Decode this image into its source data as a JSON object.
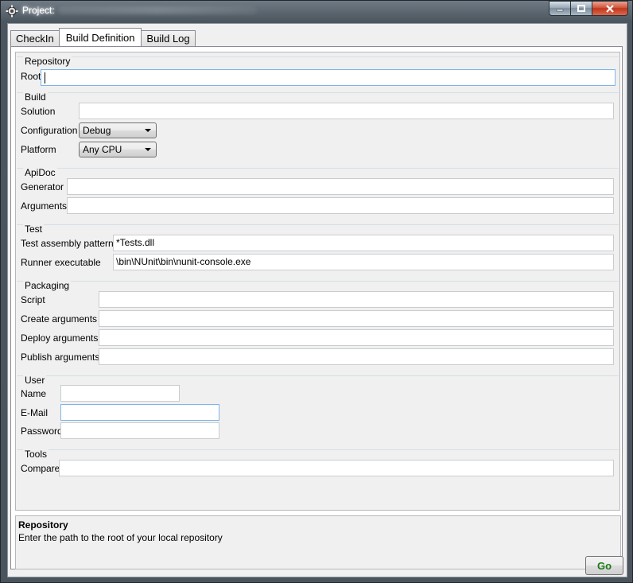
{
  "window": {
    "title": "Project:"
  },
  "tabs": [
    {
      "label": "CheckIn",
      "active": false
    },
    {
      "label": "Build Definition",
      "active": true
    },
    {
      "label": "Build Log",
      "active": false
    }
  ],
  "sections": {
    "repository": {
      "title": "Repository",
      "root_label": "Root",
      "root_value": ""
    },
    "build": {
      "title": "Build",
      "solution_label": "Solution",
      "solution_value": "",
      "configuration_label": "Configuration",
      "configuration_value": "Debug",
      "platform_label": "Platform",
      "platform_value": "Any CPU"
    },
    "apidoc": {
      "title": "ApiDoc",
      "generator_label": "Generator",
      "generator_value": "",
      "arguments_label": "Arguments",
      "arguments_value": ""
    },
    "test": {
      "title": "Test",
      "pattern_label": "Test assembly pattern",
      "pattern_value": "*Tests.dll",
      "runner_label": "Runner executable",
      "runner_value": "\\bin\\NUnit\\bin\\nunit-console.exe"
    },
    "packaging": {
      "title": "Packaging",
      "script_label": "Script",
      "script_value": "",
      "create_label": "Create arguments",
      "create_value": "",
      "deploy_label": "Deploy arguments",
      "deploy_value": "",
      "publish_label": "Publish arguments",
      "publish_value": ""
    },
    "user": {
      "title": "User",
      "name_label": "Name",
      "name_value": "",
      "email_label": "E-Mail",
      "email_value": "",
      "password_label": "Password",
      "password_value": ""
    },
    "tools": {
      "title": "Tools",
      "compare_label": "Compare",
      "compare_value": ""
    }
  },
  "help": {
    "title": "Repository",
    "text": "Enter the path to the root of your local repository"
  },
  "actions": {
    "go_label": "Go"
  },
  "colors": {
    "go_text": "#1a7a1a",
    "focus_border": "#7eb4ea"
  }
}
